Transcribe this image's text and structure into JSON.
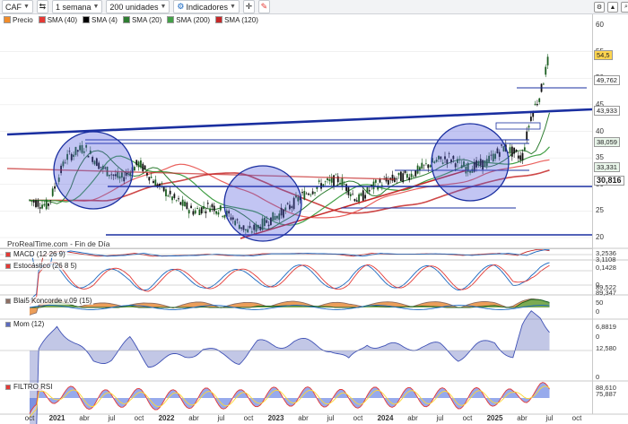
{
  "toolbar": {
    "symbol": "CAF",
    "period": "1 semana",
    "units": "200 unidades",
    "indicators_label": "Indicadores"
  },
  "legend": [
    {
      "label": "Precio",
      "color": "#f28c28"
    },
    {
      "label": "SMA (40)",
      "color": "#e53935"
    },
    {
      "label": "SMA (4)",
      "color": "#000000"
    },
    {
      "label": "SMA (20)",
      "color": "#2e7d32"
    },
    {
      "label": "SMA (200)",
      "color": "#43a047"
    },
    {
      "label": "SMA (120)",
      "color": "#c62828"
    }
  ],
  "watermark": "ProRealTime.com - Fin de Día",
  "price_axis": {
    "ticks": [
      "60",
      "55",
      "50",
      "45",
      "40",
      "35",
      "30",
      "25",
      "20"
    ],
    "badges": [
      {
        "text": "54,5",
        "bg": "#ffd54f"
      },
      {
        "text": "49,762",
        "bg": "#ffffff"
      },
      {
        "text": "43,933",
        "bg": "#ffffff"
      },
      {
        "text": "38,059",
        "bg": "#e8f5e9"
      },
      {
        "text": "33,331",
        "bg": "#e8f5e9"
      },
      {
        "text": "30,816",
        "bg": "#ffffff"
      }
    ]
  },
  "panes": {
    "macd": {
      "label": "MACD (12 26 9)",
      "values": [
        "3,2536",
        "3,1108",
        "0,1428",
        "0"
      ]
    },
    "stoch": {
      "label": "Estocástico (26 8 5)",
      "values": [
        "89,522",
        "89,347",
        "50",
        "0"
      ]
    },
    "koncorde": {
      "label": "Blai5 Koncorde v.09 (15)",
      "values": [
        "6,8819",
        "0"
      ]
    },
    "mom": {
      "label": "Mom (12)",
      "values": [
        "12,580",
        "0"
      ]
    },
    "rsi": {
      "label": "FILTRO RSI",
      "values": [
        "88,610",
        "75,887"
      ]
    }
  },
  "x_axis": [
    {
      "label": "oct",
      "bold": false
    },
    {
      "label": "2021",
      "bold": true
    },
    {
      "label": "abr",
      "bold": false
    },
    {
      "label": "jul",
      "bold": false
    },
    {
      "label": "oct",
      "bold": false
    },
    {
      "label": "2022",
      "bold": true
    },
    {
      "label": "abr",
      "bold": false
    },
    {
      "label": "jul",
      "bold": false
    },
    {
      "label": "oct",
      "bold": false
    },
    {
      "label": "2023",
      "bold": true
    },
    {
      "label": "abr",
      "bold": false
    },
    {
      "label": "jul",
      "bold": false
    },
    {
      "label": "oct",
      "bold": false
    },
    {
      "label": "2024",
      "bold": true
    },
    {
      "label": "abr",
      "bold": false
    },
    {
      "label": "jul",
      "bold": false
    },
    {
      "label": "oct",
      "bold": false
    },
    {
      "label": "2025",
      "bold": true
    },
    {
      "label": "abr",
      "bold": false
    },
    {
      "label": "jul",
      "bold": false
    },
    {
      "label": "oct",
      "bold": false
    }
  ],
  "chart_data": {
    "type": "line",
    "series": [
      {
        "name": "Precio",
        "x": [
          "2020-10",
          "2020-12",
          "2021-02",
          "2021-04",
          "2021-06",
          "2021-08",
          "2021-10",
          "2021-12",
          "2022-02",
          "2022-04",
          "2022-06",
          "2022-08",
          "2022-10",
          "2022-12",
          "2023-02",
          "2023-04",
          "2023-06",
          "2023-08",
          "2023-10",
          "2023-12",
          "2024-02",
          "2024-04",
          "2024-06",
          "2024-08",
          "2024-10",
          "2024-12",
          "2025-02",
          "2025-04",
          "2025-05",
          "2025-06",
          "2025-07"
        ],
        "values": [
          27,
          26,
          35,
          37,
          33,
          31,
          34,
          30,
          27,
          25,
          26,
          24,
          21,
          23,
          25,
          28,
          30,
          31,
          27,
          30,
          31,
          32,
          34,
          35,
          33,
          34,
          37,
          35,
          43,
          47,
          54.5
        ]
      }
    ],
    "ylim": [
      20,
      60
    ],
    "colors": {
      "up": "#1b5e20",
      "down": "#111111"
    }
  }
}
